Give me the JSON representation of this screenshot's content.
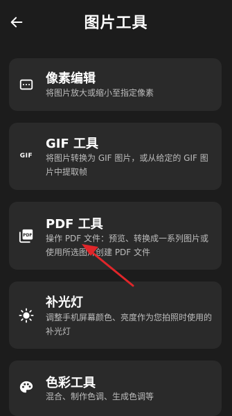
{
  "header": {
    "title": "图片工具",
    "back_icon": "arrow-left-icon"
  },
  "tools": [
    {
      "title": "像素编辑",
      "description": "将图片放大或缩小至指定像素",
      "icon": "pixel-grid-icon"
    },
    {
      "title": "GIF 工具",
      "description": "将图片转换为 GIF 图片，或从给定的 GIF 图片中提取帧",
      "icon": "gif-icon",
      "icon_text": "GIF"
    },
    {
      "title": "PDF 工具",
      "description": "操作 PDF 文件：预览、转换成一系列图片或使用所选图片创建 PDF 文件",
      "icon": "pdf-icon",
      "icon_text": "PDF"
    },
    {
      "title": "补光灯",
      "description": "调整手机屏幕颜色、亮度作为您拍照时使用的补光灯",
      "icon": "brightness-icon"
    },
    {
      "title": "色彩工具",
      "description": "混合、制作色调、生成色调等",
      "icon": "palette-icon"
    }
  ],
  "colors": {
    "background": "#1c1c1c",
    "card": "#2a2a2a",
    "annotation_arrow": "#e0262a"
  }
}
